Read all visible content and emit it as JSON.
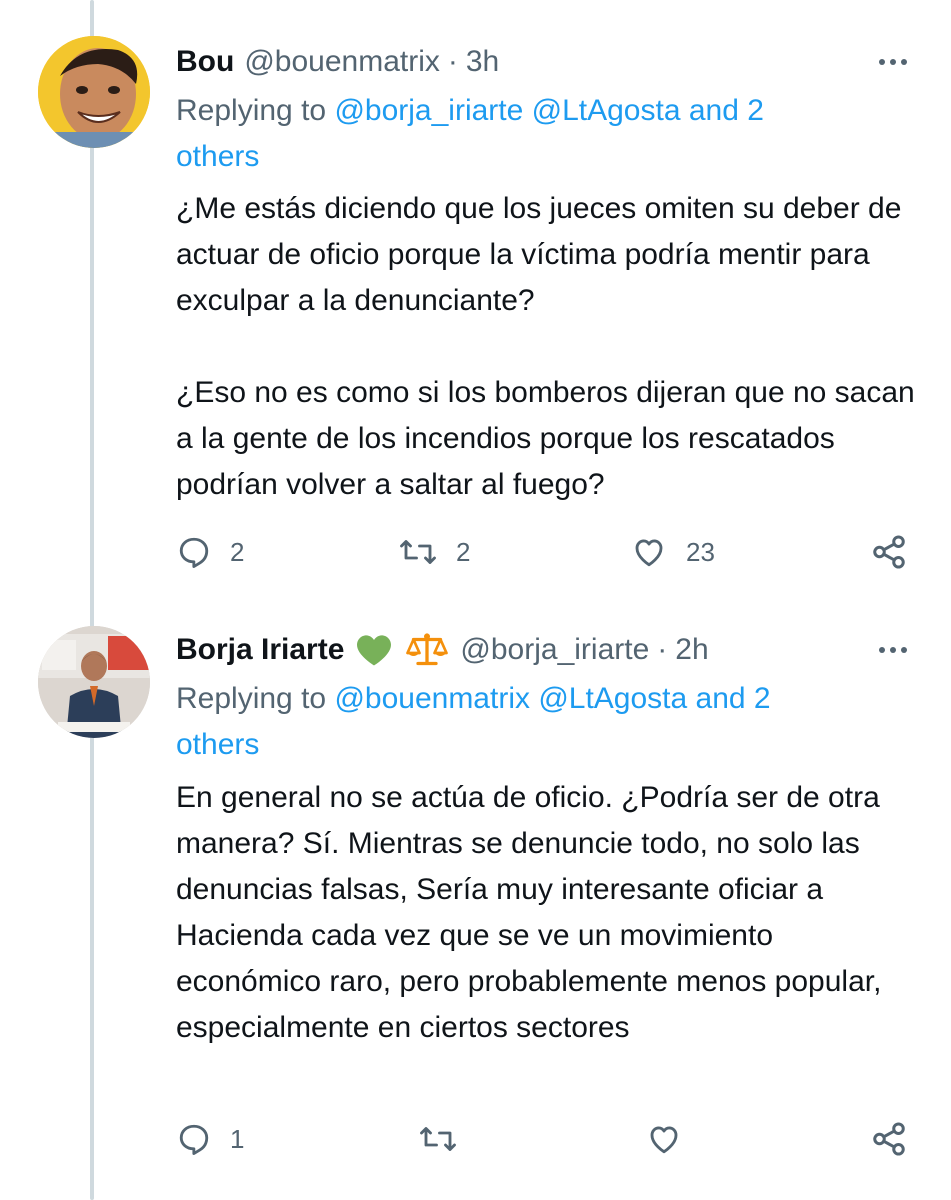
{
  "tweets": [
    {
      "name": "Bou",
      "handle": "@bouenmatrix",
      "separator": "·",
      "time": "3h",
      "replying_prefix": "Replying to",
      "replying_mentions": "@borja_iriarte @LtAgosta and 2",
      "replying_others": "others",
      "paragraphs": [
        "¿Me estás diciendo que los jueces omiten su deber de actuar de oficio porque la víctima podría mentir para exculpar a la denunciante?",
        "¿Eso no es como si los bomberos dijeran que no sacan a la gente de los incendios porque los rescatados podrían volver a saltar al fuego?"
      ],
      "replies": "2",
      "retweets": "2",
      "likes": "23"
    },
    {
      "name": "Borja Iriarte",
      "badges": [
        "green-heart-icon",
        "balance-scale-icon"
      ],
      "handle": "@borja_iriarte",
      "separator": "·",
      "time": "2h",
      "replying_prefix": "Replying to",
      "replying_mentions": "@bouenmatrix @LtAgosta and 2",
      "replying_others": "others",
      "paragraphs": [
        "En general no se actúa de oficio. ¿Podría ser de otra manera? Sí. Mientras se denuncie todo, no solo las denuncias falsas, Sería muy interesante oficiar a Hacienda cada vez que se ve un movimiento económico raro, pero probablemente menos popular, especialmente en ciertos sectores"
      ],
      "replies": "1",
      "retweets": "",
      "likes": ""
    }
  ],
  "colors": {
    "text": "#0f1419",
    "secondary": "#536471",
    "link": "#1d9bf0",
    "thread_line": "#cfd9de",
    "heart_badge": "#78b159",
    "scale_badge": "#f4900c"
  }
}
